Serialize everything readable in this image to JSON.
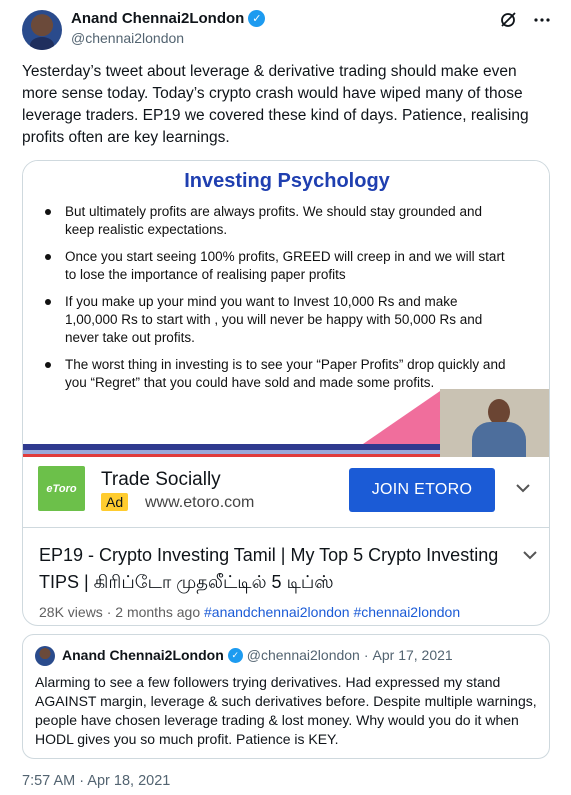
{
  "author": {
    "name": "Anand Chennai2London",
    "handle": "@chennai2london"
  },
  "tweet": {
    "text": "Yesterday’s tweet about leverage & derivative trading should make even more sense today. Today’s crypto crash would have wiped many of those leverage traders. EP19 we covered these kind of days. Patience, realising profits often are key learnings.",
    "timestamp": "7:57 AM · Apr 18, 2021"
  },
  "icons": {
    "verified": "verified-badge-icon",
    "grok": "grok-icon",
    "more": "more-icon",
    "chevron": "chevron-down-icon"
  },
  "card": {
    "slide": {
      "title": "Investing Psychology",
      "bullets": [
        "But ultimately profits are always profits. We should stay grounded and keep realistic expectations.",
        "Once you start seeing 100% profits, GREED will creep in and we will start to lose the importance of realising paper profits",
        "If you make up your mind you want to Invest 10,000 Rs and make 1,00,000 Rs to start with , you will never be happy with 50,000 Rs and never take out profits.",
        "The worst thing in investing is to see your “Paper Profits” drop quickly and you “Regret” that you could have sold and made some profits."
      ]
    },
    "ad": {
      "logo_text": "eToro",
      "title": "Trade Socially",
      "badge": "Ad",
      "url": "www.etoro.com",
      "button": "JOIN ETORO"
    },
    "video": {
      "title": "EP19 - Crypto Investing Tamil | My Top 5 Crypto Investing TIPS | கிரிப்டோ முதலீட்டில் 5 டிப்ஸ்",
      "views": "28K views",
      "age": "2 months ago",
      "tags": "#anandchennai2london #chennai2london"
    }
  },
  "quote": {
    "name": "Anand Chennai2London",
    "handle": "@chennai2london",
    "separator": "·",
    "date": "Apr 17, 2021",
    "text": "Alarming to see a few followers trying derivatives. Had expressed my stand AGAINST margin, leverage & such derivatives before. Despite multiple warnings, people have chosen leverage trading & lost money. Why would you do it when HODL gives you so much profit. Patience is KEY."
  },
  "colors": {
    "verified": "#1d9bf0",
    "slide_title": "#1f3fb0",
    "join_button": "#1b5bd6",
    "etoro_green": "#6cc04a",
    "ad_badge": "#ffcc2f",
    "muted": "#536471"
  }
}
